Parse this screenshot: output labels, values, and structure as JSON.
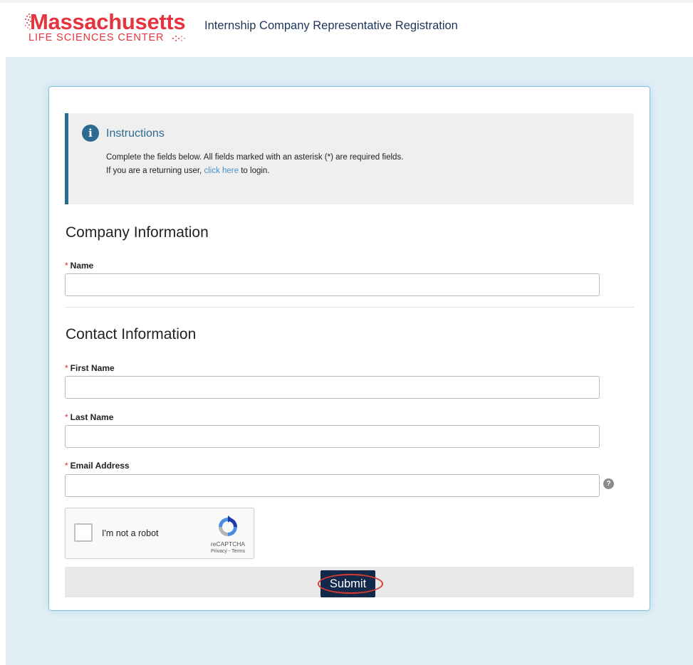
{
  "header": {
    "logo_main": "Massachusetts",
    "logo_sub": "LIFE SCIENCES CENTER",
    "title": "Internship Company Representative Registration"
  },
  "instructions": {
    "icon": "info-icon",
    "title": "Instructions",
    "line1": "Complete the fields below. All fields marked with an asterisk (*) are required fields.",
    "line2_prefix": "If you are a returning user,",
    "line2_link": "click here",
    "line2_suffix": "to login."
  },
  "company": {
    "section_title": "Company Information",
    "name_label": "Name",
    "name_value": ""
  },
  "contact": {
    "section_title": "Contact Information",
    "first_name_label": "First Name",
    "first_name_value": "",
    "last_name_label": "Last Name",
    "last_name_value": "",
    "email_label": "Email Address",
    "email_value": "",
    "email_help": "?"
  },
  "required_marker": "*",
  "captcha": {
    "label": "I'm not a robot",
    "brand": "reCAPTCHA",
    "terms": "Privacy - Terms"
  },
  "form": {
    "submit_label": "Submit"
  },
  "colors": {
    "brand_red": "#e5343d",
    "accent_blue": "#2d6a8f",
    "submit_navy": "#13294b",
    "link_blue": "#4a90c8",
    "required_red": "#d2322d"
  }
}
